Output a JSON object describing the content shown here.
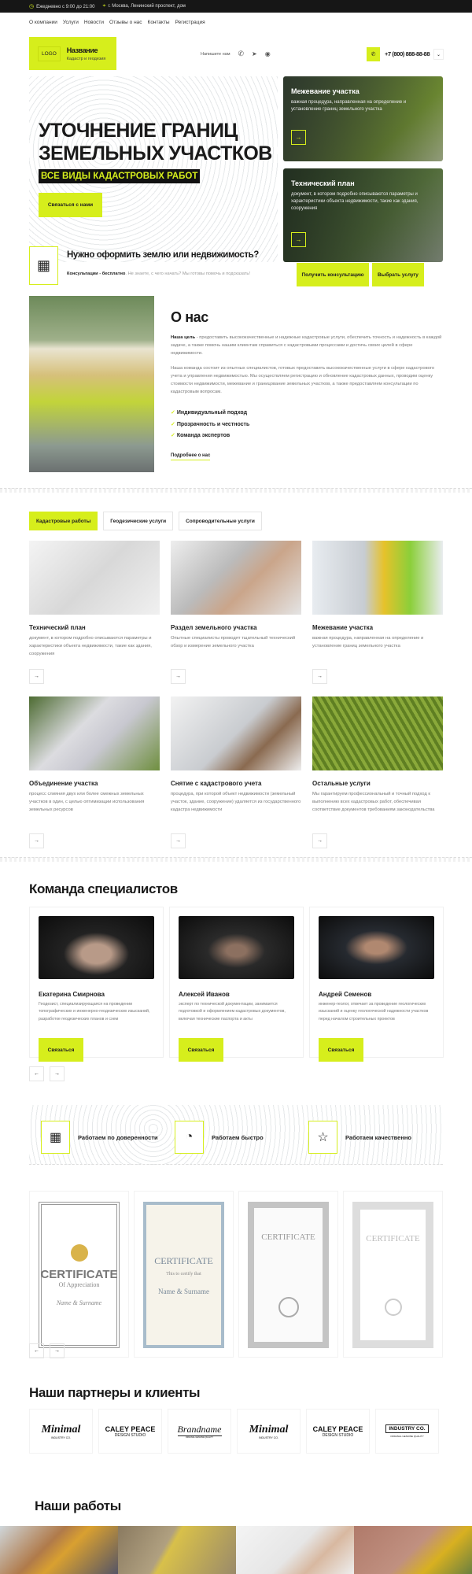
{
  "topbar": {
    "hours": "Ежедневно с 9:00 до 21:00",
    "address": "г. Москва, Ленинский проспект, дом"
  },
  "nav": [
    "О компании",
    "Услуги",
    "Новости",
    "Отзывы о нас",
    "Контакты",
    "Регистрация"
  ],
  "header": {
    "logo": "LOGO",
    "name": "Название",
    "tagline": "Кадастр и геодезия",
    "write_us": "Напишите нам",
    "phone": "+7 (800) 888-88-88"
  },
  "hero": {
    "title_line1": "УТОЧНЕНИЕ ГРАНИЦ",
    "title_line2": "ЗЕМЕЛЬНЫХ УЧАСТКОВ",
    "subtitle": "ВСЕ ВИДЫ КАДАСТРОВЫХ РАБОТ",
    "cta": "Связаться с нами",
    "cards": [
      {
        "title": "Межевание участка",
        "text": "важная процедура, направленная на определение и установление границ земельного участка"
      },
      {
        "title": "Технический план",
        "text": "документ, в котором подробно описываются параметры и характеристики объекта недвижимости, такие как здания, сооружения"
      }
    ]
  },
  "cta": {
    "title": "Нужно оформить землю или недвижимость?",
    "bold": "Консультации - бесплатно",
    "text": ". Не знаете, с чего начать? Мы готовы помочь и подсказать!",
    "btn1": "Получить консультацию",
    "btn2": "Выбрать услугу"
  },
  "about": {
    "title": "О нас",
    "p1_bold": "Наша цель",
    "p1": " - предоставить высококачественные и надежные кадастровые услуги, обеспечить точность и надежность в каждой задаче, а также помочь нашим клиентам справиться с кадастровыми процессами и достичь своих целей в сфере недвижимости.",
    "p2": "Наша команда состоит из опытных специалистов, готовых предоставить высококачественные услуги в сфере кадастрового учета и управления недвижимостью. Мы осуществляем регистрацию и обновление кадастровых данных, проводим оценку стоимости недвижимости, межевание и границование земельных участков, а также предоставляем консультации по кадастровым вопросам.",
    "list": [
      "Индивидуальный подход",
      "Прозрачность и честность",
      "Команда экспертов"
    ],
    "more": "Подробнее о нас"
  },
  "tabs": [
    "Кадастровые работы",
    "Геодезические услуги",
    "Сопроводительные услуги"
  ],
  "services": [
    {
      "title": "Технический план",
      "text": "документ, в котором подробно описываются параметры и характеристики объекта недвижимости, такие как здания, сооружения"
    },
    {
      "title": "Раздел земельного участка",
      "text": "Опытные специалисты проводят тщательный технический обзор и измерение земельного участка"
    },
    {
      "title": "Межевание участка",
      "text": "важная процедура, направленная на определение и установление границ земельного участка"
    },
    {
      "title": "Объединение участка",
      "text": "процесс слияния двух или более смежных земельных участков в один, с целью оптимизации использования земельных ресурсов"
    },
    {
      "title": "Снятие с кадастрового учета",
      "text": "процедура, при которой объект недвижимости (земельный участок, здание, сооружение) удаляется из государственного кадастра недвижимости"
    },
    {
      "title": "Остальные услуги",
      "text": "Мы гарантируем профессиональный и точный подход к выполнению всех кадастровых работ, обеспечивая соответствие документов требованиям законодательства"
    }
  ],
  "team": {
    "title": "Команда специалистов",
    "contact": "Связаться",
    "members": [
      {
        "name": "Екатерина Смирнова",
        "text": "Геодезист, специализирующаяся на проведении топографических и инженерно-геодезических изысканий, разработке геодезических планов и схем"
      },
      {
        "name": "Алексей Иванов",
        "text": "эксперт по технической документации, занимается подготовкой и оформлением кадастровых документов, включая технические паспорта и акты"
      },
      {
        "name": "Андрей Семенов",
        "text": "инженер-геолог, отвечает за проведение геологических изысканий и оценку геологической надежности участков перед началом строительных проектов"
      }
    ]
  },
  "features": [
    "Работаем по доверенности",
    "Работаем быстро",
    "Работаем качественно"
  ],
  "certificates": [
    {
      "title": "CERTIFICATE",
      "sub": "Of Appreciation",
      "name": "Name & Surname"
    },
    {
      "title": "CERTIFICATE",
      "sub": "This to certify that",
      "name": "Name & Surname"
    },
    {
      "title": "CERTIFICATE",
      "sub": "",
      "name": ""
    },
    {
      "title": "CERTIFICATE",
      "sub": "",
      "name": ""
    }
  ],
  "partners": {
    "title": "Наши партнеры и клиенты",
    "logos": [
      {
        "main": "Minimal",
        "sub": "INDUSTRY CO."
      },
      {
        "main": "CALEY PEACE",
        "sub": "DESIGN STUDIO"
      },
      {
        "main": "Brandname",
        "sub": "ORIGINAL GENUINE QUALITY"
      },
      {
        "main": "Minimal",
        "sub": "INDUSTRY CO."
      },
      {
        "main": "CALEY PEACE",
        "sub": "DESIGN STUDIO"
      },
      {
        "main": "INDUSTRY CO.",
        "sub": "ORIGINAL GENUINE QUALITY"
      }
    ]
  },
  "works": {
    "title": "Наши работы"
  },
  "colors": {
    "accent": "#d6ee1c",
    "dark": "#161616"
  }
}
